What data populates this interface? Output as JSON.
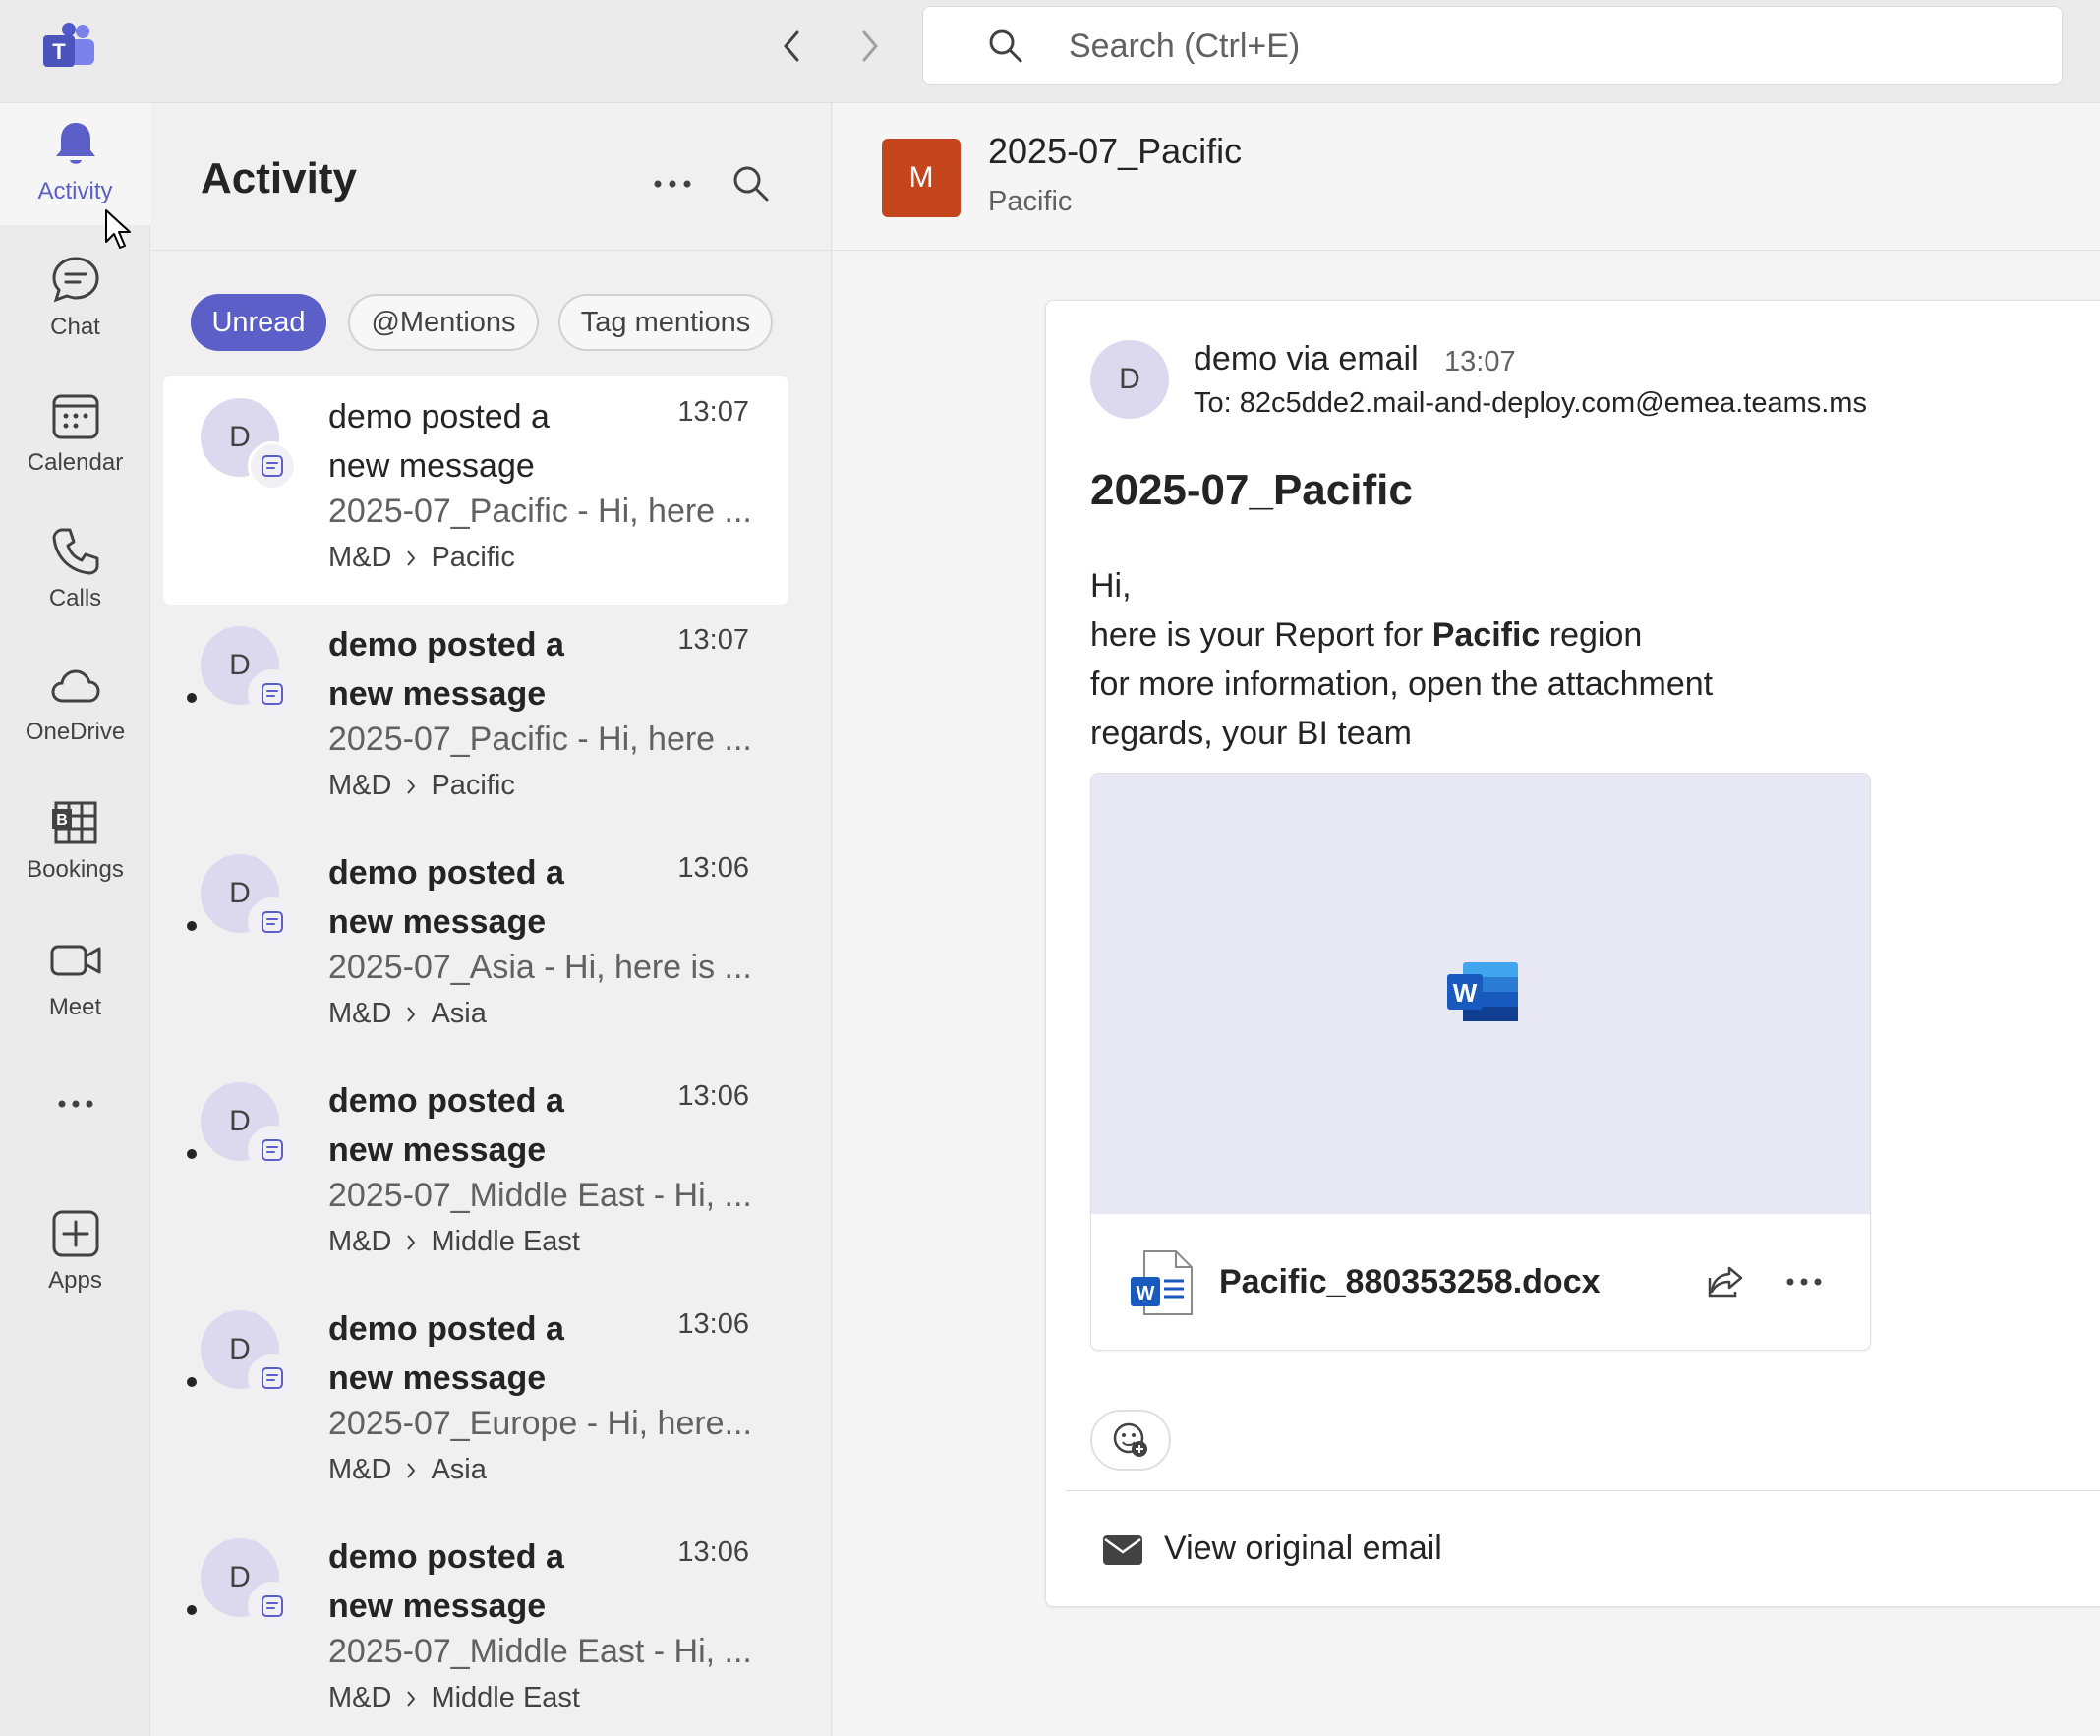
{
  "app": {
    "search_placeholder": "Search (Ctrl+E)"
  },
  "rail": {
    "items": [
      {
        "label": "Activity",
        "icon": "bell-icon"
      },
      {
        "label": "Chat",
        "icon": "chat-icon"
      },
      {
        "label": "Calendar",
        "icon": "calendar-icon"
      },
      {
        "label": "Calls",
        "icon": "phone-icon"
      },
      {
        "label": "OneDrive",
        "icon": "cloud-icon"
      },
      {
        "label": "Bookings",
        "icon": "bookings-icon"
      },
      {
        "label": "Meet",
        "icon": "video-icon"
      },
      {
        "label": "Apps",
        "icon": "add-app-icon"
      }
    ]
  },
  "activity": {
    "title": "Activity",
    "filters": [
      {
        "label": "Unread",
        "active": true
      },
      {
        "label": "@Mentions",
        "active": false
      },
      {
        "label": "Tag mentions",
        "active": false
      }
    ],
    "items": [
      {
        "avatar": "D",
        "title_line1": "demo posted a",
        "title_line2": "new message",
        "time": "13:07",
        "preview": "2025-07_Pacific - Hi, here ...",
        "team": "M&D",
        "channel": "Pacific",
        "unread": false,
        "selected": true
      },
      {
        "avatar": "D",
        "title_line1": "demo posted a",
        "title_line2": "new message",
        "time": "13:07",
        "preview": "2025-07_Pacific - Hi, here ...",
        "team": "M&D",
        "channel": "Pacific",
        "unread": true,
        "selected": false
      },
      {
        "avatar": "D",
        "title_line1": "demo posted a",
        "title_line2": "new message",
        "time": "13:06",
        "preview": "2025-07_Asia - Hi, here is ...",
        "team": "M&D",
        "channel": "Asia",
        "unread": true,
        "selected": false
      },
      {
        "avatar": "D",
        "title_line1": "demo posted a",
        "title_line2": "new message",
        "time": "13:06",
        "preview": "2025-07_Middle East - Hi, ...",
        "team": "M&D",
        "channel": "Middle East",
        "unread": true,
        "selected": false
      },
      {
        "avatar": "D",
        "title_line1": "demo posted a",
        "title_line2": "new message",
        "time": "13:06",
        "preview": "2025-07_Europe - Hi, here...",
        "team": "M&D",
        "channel": "Asia",
        "unread": true,
        "selected": false
      },
      {
        "avatar": "D",
        "title_line1": "demo posted a",
        "title_line2": "new message",
        "time": "13:06",
        "preview": "2025-07_Middle East - Hi, ...",
        "team": "M&D",
        "channel": "Middle East",
        "unread": true,
        "selected": false
      }
    ]
  },
  "channel": {
    "avatar": "M",
    "title": "2025-07_Pacific",
    "subtitle": "Pacific",
    "avatar_color": "#c4441c"
  },
  "message": {
    "avatar": "D",
    "sender": "demo via email",
    "time": "13:07",
    "to": "To: 82c5dde2.mail-and-deploy.com@emea.teams.ms",
    "subject": "2025-07_Pacific",
    "body_line1": "Hi,",
    "body_line2_pre": "here is your Report for ",
    "body_line2_bold": "Pacific",
    "body_line2_post": " region",
    "body_line3": "for more information, open the attachment",
    "body_line4": "regards, your BI team",
    "attachment_name": "Pacific_880353258.docx",
    "view_original": "View original email"
  },
  "colors": {
    "accent": "#5b5fc7",
    "word_blue": "#185abd"
  }
}
